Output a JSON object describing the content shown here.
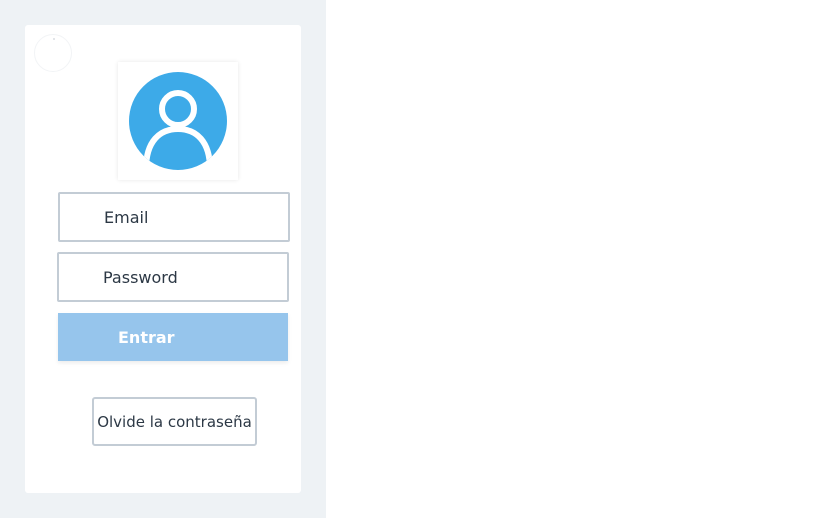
{
  "login": {
    "email_placeholder": "Email",
    "password_placeholder": "Password",
    "submit_label": "Entrar",
    "forgot_label": "Olvide la contraseña"
  },
  "avatar": {
    "icon": "user-icon",
    "color": "#3daae8"
  },
  "colors": {
    "panel_background": "#eef2f5",
    "submit_button": "#96c5ec",
    "field_border": "#c3ccd5"
  }
}
